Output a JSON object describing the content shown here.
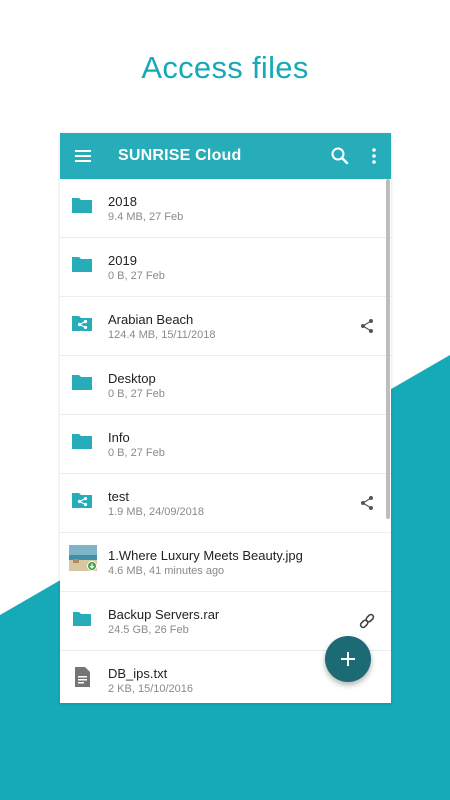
{
  "promo": {
    "headline": "Access files"
  },
  "colors": {
    "accent": "#26adb9",
    "headline": "#16a9b8",
    "fab": "#1c6a73",
    "icon": "#26adb9"
  },
  "appbar": {
    "title": "SUNRISE Cloud",
    "menu_icon": "menu-icon",
    "search_icon": "search-icon",
    "more_icon": "more-vert-icon"
  },
  "files": [
    {
      "name": "2018",
      "meta": "9.4 MB, 27 Feb",
      "icon": "folder-icon",
      "action": ""
    },
    {
      "name": "2019",
      "meta": "0 B, 27 Feb",
      "icon": "folder-icon",
      "action": ""
    },
    {
      "name": "Arabian Beach",
      "meta": "124.4 MB, 15/11/2018",
      "icon": "shared-folder-icon",
      "action": "share-icon"
    },
    {
      "name": "Desktop",
      "meta": "0 B, 27 Feb",
      "icon": "folder-icon",
      "action": ""
    },
    {
      "name": "Info",
      "meta": "0 B, 27 Feb",
      "icon": "folder-icon",
      "action": ""
    },
    {
      "name": "test",
      "meta": "1.9 MB, 24/09/2018",
      "icon": "shared-folder-icon",
      "action": "share-icon"
    },
    {
      "name": "1.Where Luxury Meets Beauty.jpg",
      "meta": "4.6 MB, 41 minutes ago",
      "icon": "image-thumbnail",
      "action": ""
    },
    {
      "name": "Backup Servers.rar",
      "meta": "24.5 GB, 26 Feb",
      "icon": "archive-icon",
      "action": "link-icon"
    },
    {
      "name": "DB_ips.txt",
      "meta": "2 KB, 15/10/2016",
      "icon": "text-file-icon",
      "action": ""
    }
  ],
  "fab": {
    "icon": "add-icon"
  }
}
